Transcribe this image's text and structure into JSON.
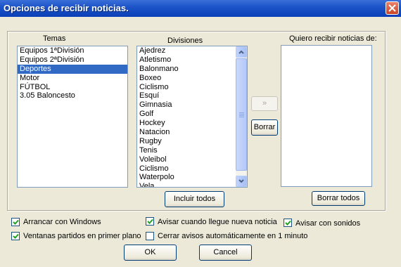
{
  "window": {
    "title": "Opciones de recibir noticias."
  },
  "temas": {
    "label": "Temas",
    "items": [
      "Equipos 1ªDivisión",
      "Equipos 2ªDivisión",
      "Deportes",
      "Motor",
      "FÚTBOL",
      "3.05 Baloncesto"
    ],
    "selected": "Deportes"
  },
  "divisiones": {
    "label": "Divisiones",
    "items": [
      "Ajedrez",
      "Atletismo",
      "Balonmano",
      "Boxeo",
      "Ciclismo",
      "Esquí",
      "Gimnasia",
      "Golf",
      "Hockey",
      "Natacion",
      "Rugby",
      "Tenis",
      "Voleibol",
      "Ciclismo",
      "Waterpolo",
      "Vela"
    ]
  },
  "recibir": {
    "label": "Quiero recibir noticias de:"
  },
  "buttons": {
    "add": "»",
    "borrar": "Borrar",
    "incluir_todos": "Incluir todos",
    "borrar_todos": "Borrar todos",
    "ok": "OK",
    "cancel": "Cancel"
  },
  "options": {
    "arrancar": {
      "label": "Arrancar con Windows",
      "checked": true
    },
    "avisar_noticia": {
      "label": "Avisar cuando llegue nueva noticia",
      "checked": true
    },
    "avisar_sonidos": {
      "label": "Avisar con sonidos",
      "checked": true
    },
    "ventanas": {
      "label": "Ventanas partidos en primer plano",
      "checked": true
    },
    "cerrar_avisos": {
      "label": "Cerrar avisos automáticamente en 1 minuto",
      "checked": false
    }
  },
  "colors": {
    "titlebar": "#0a3fb8",
    "selection": "#316ac5",
    "dialog_bg": "#ece9d8"
  }
}
